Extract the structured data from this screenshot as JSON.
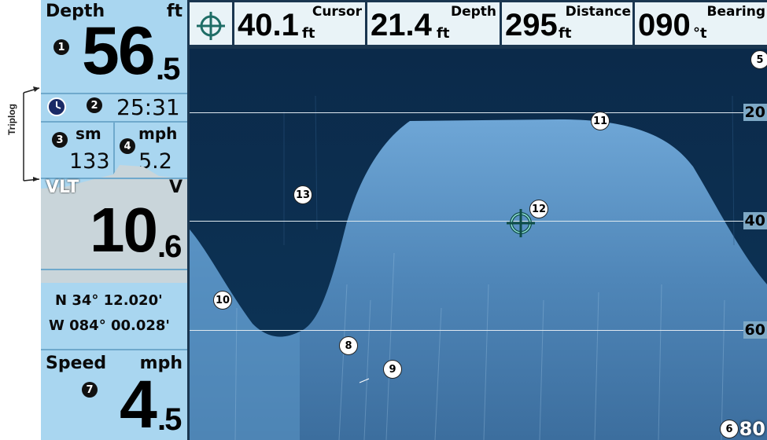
{
  "triplog_label": "Triplog",
  "left": {
    "depth_label": "Depth",
    "depth_unit": "ft",
    "depth_int": "56",
    "depth_dec": ".5",
    "timer": "25:31",
    "dist_unit": "sm",
    "speed_unit_top": "mph",
    "trip_distance": "133",
    "trip_speed": "5.2",
    "volt_label": "VLT",
    "volt_unit": "V",
    "volt_int": "10",
    "volt_dec": ".6",
    "lat": "N 34° 12.020'",
    "lon": "W 084° 00.028'",
    "speed_label": "Speed",
    "speed_unit": "mph",
    "speed_int": "4",
    "speed_dec": ".5"
  },
  "topbar": {
    "cursor": {
      "label": "Cursor",
      "value": "40.1",
      "unit": "ft"
    },
    "depth": {
      "label": "Depth",
      "value": "21.4",
      "unit": "ft"
    },
    "distance": {
      "label": "Distance",
      "value": "295",
      "unit": "ft"
    },
    "bearing": {
      "label": "Bearing",
      "value": "090",
      "unit": "°t"
    }
  },
  "sonar": {
    "depth_marks": [
      "20",
      "40",
      "60"
    ],
    "range": "80"
  },
  "callouts": [
    "1",
    "2",
    "3",
    "4",
    "5",
    "6",
    "7",
    "8",
    "9",
    "10",
    "11",
    "12",
    "13"
  ],
  "icons": {
    "clock": "clock-icon",
    "cursor": "crosshair-icon"
  },
  "colors": {
    "panel": "#a9d6f0",
    "water": "#0b2a4a",
    "bottom": "#5b93c4",
    "border": "#1a3650"
  }
}
